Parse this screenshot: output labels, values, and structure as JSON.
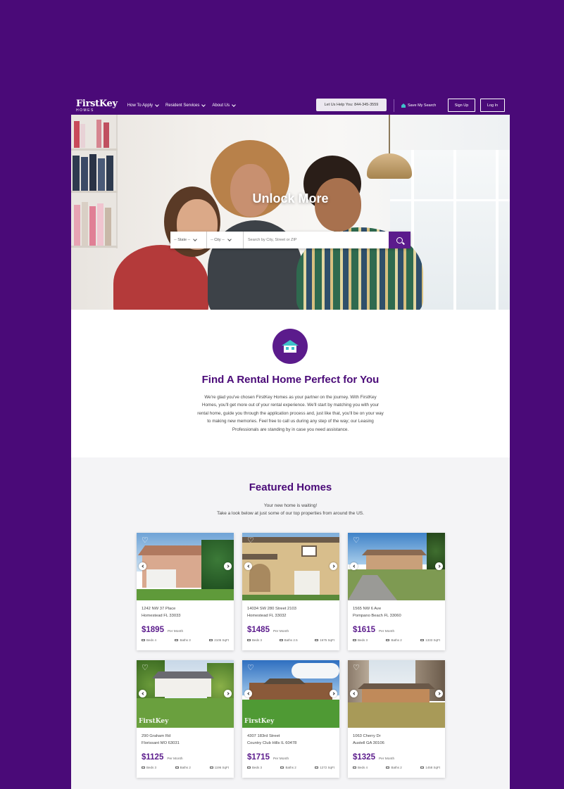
{
  "header": {
    "logo": "FirstKey",
    "logo_sub": "HOMES",
    "nav": [
      {
        "label": "How To Apply"
      },
      {
        "label": "Resident Services"
      },
      {
        "label": "About Us"
      }
    ],
    "help": "Let Us Help You: 844-345-3559",
    "save_search": "Save My Search",
    "signup": "Sign Up",
    "login": "Log In"
  },
  "hero": {
    "title": "Unlock More",
    "state": "-- State --",
    "city": "-- City --",
    "placeholder": "Search by City, Street or ZIP"
  },
  "intro": {
    "title": "Find A Rental Home Perfect for You",
    "body": "We're glad you've chosen FirstKey Homes as your partner on the journey. With FirstKey Homes, you'll get more out of your rental experience. We'll start by matching you with your rental home, guide you through the application process and, just like that, you'll be on your way to making new memories. Feel free to call us during any step of the way; our Leasing Professionals are standing by in case you need assistance."
  },
  "featured": {
    "title": "Featured Homes",
    "sub1": "Your new home is waiting!",
    "sub2": "Take a look below at just some of our top properties from around the US.",
    "per_month": "Per Month",
    "listings": [
      {
        "street": "1242 NW 37 Place",
        "city": "Homestead FL 33033",
        "price": "$1895",
        "beds": "Beds 4",
        "baths": "Baths 3",
        "sqft": "2105 SqFt"
      },
      {
        "street": "14034 SW 280 Street 2103",
        "city": "Homestead FL 33032",
        "price": "$1485",
        "beds": "Beds 3",
        "baths": "Baths 2.5",
        "sqft": "1675 SqFt"
      },
      {
        "street": "1565 NW 6 Ave",
        "city": "Pompano Beach FL 33060",
        "price": "$1615",
        "beds": "Beds 3",
        "baths": "Baths 2",
        "sqft": "1333 SqFt"
      },
      {
        "street": "290 Graham Rd",
        "city": "Florissant MO 63031",
        "price": "$1125",
        "beds": "Beds 3",
        "baths": "Baths 2",
        "sqft": "1196 SqFt"
      },
      {
        "street": "4307 183rd Street",
        "city": "Country Club Hills IL 60478",
        "price": "$1715",
        "beds": "Beds 3",
        "baths": "Baths 2",
        "sqft": "1272 SqFt"
      },
      {
        "street": "1063 Cherry Dr",
        "city": "Austell GA 30106",
        "price": "$1325",
        "beds": "Beds 4",
        "baths": "Baths 2",
        "sqft": "1458 SqFt"
      }
    ]
  },
  "colors": {
    "brand": "#4a0a78",
    "accent": "#3fc1c9",
    "price": "#5b1b8c"
  }
}
